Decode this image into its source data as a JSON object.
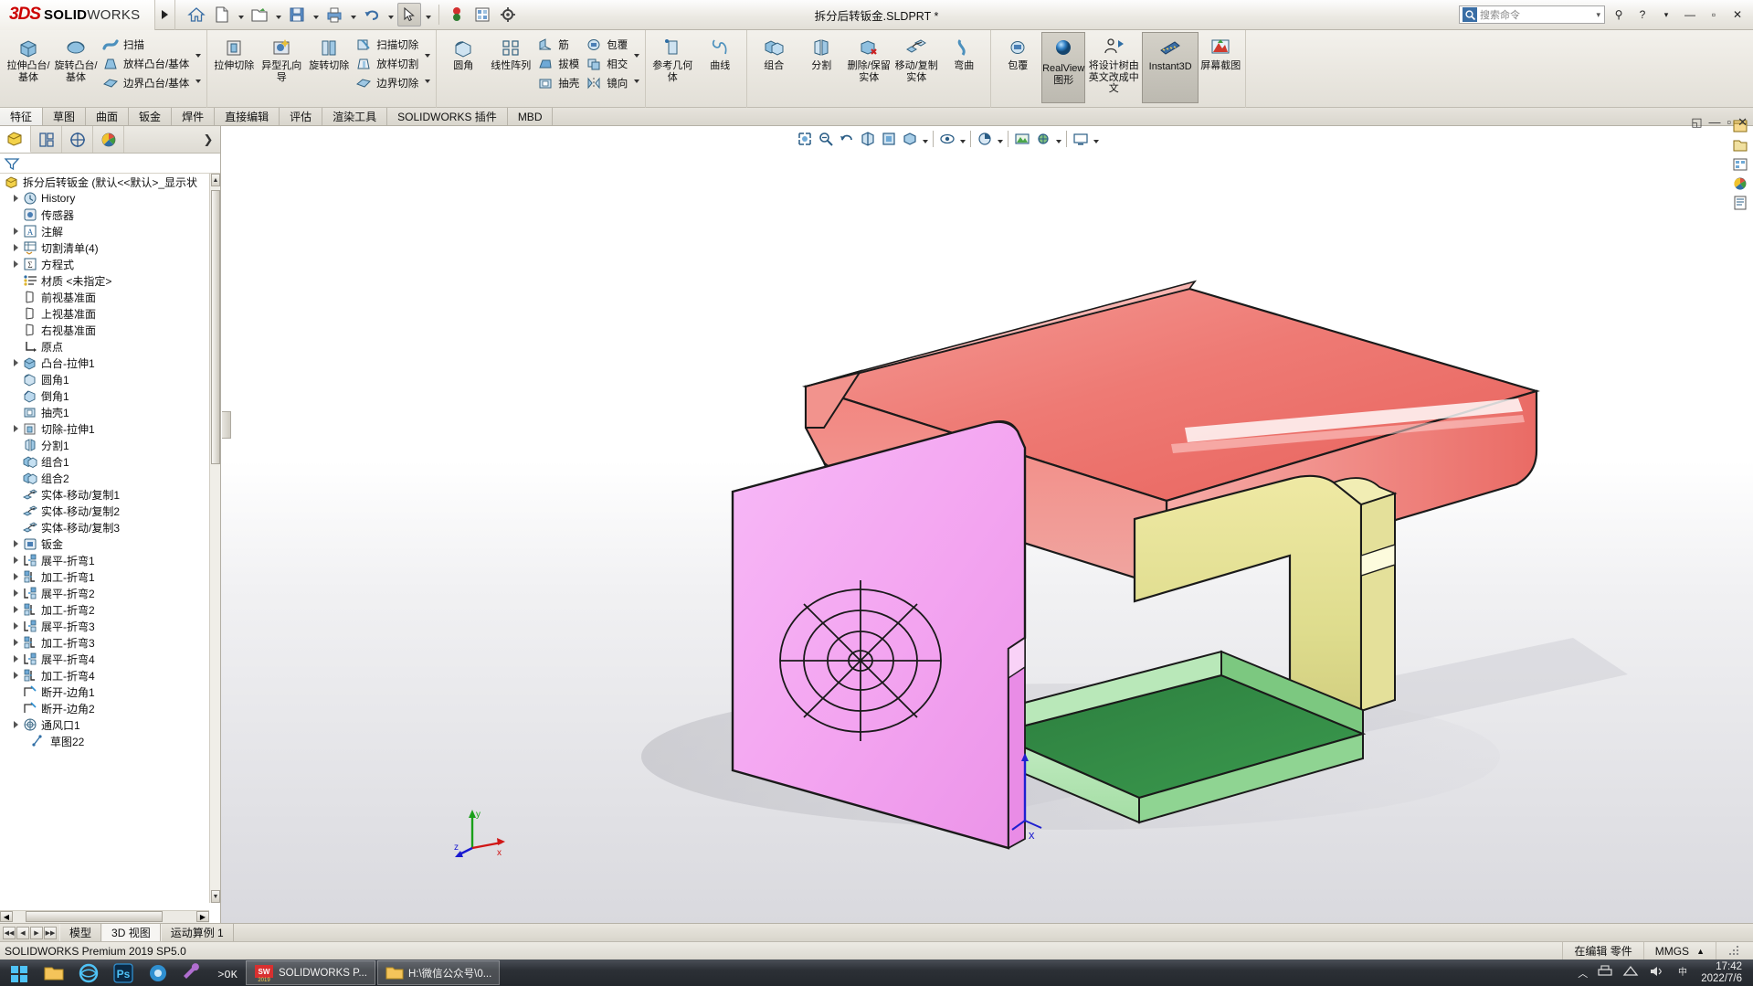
{
  "window": {
    "brand_3ds": "3DS",
    "brand_solid": "SOLID",
    "brand_works": "WORKS",
    "document_title": "拆分后转钣金.SLDPRT *",
    "search_placeholder": "搜索命令",
    "minimize": "—",
    "maximize": "▫",
    "close": "✕",
    "help": "?",
    "help_arrow": "▾",
    "pin": "⚲"
  },
  "quick_access": [
    {
      "name": "home-icon",
      "glyph": "home"
    },
    {
      "name": "new-doc-icon",
      "glyph": "newdoc"
    },
    {
      "name": "open-icon",
      "glyph": "open"
    },
    {
      "name": "save-icon",
      "glyph": "save"
    },
    {
      "name": "print-icon",
      "glyph": "print"
    },
    {
      "name": "undo-icon",
      "glyph": "undo"
    },
    {
      "name": "select-icon",
      "glyph": "cursor"
    },
    {
      "name": "rebuild-icon",
      "glyph": "rebuild"
    },
    {
      "name": "display-icon",
      "glyph": "display"
    },
    {
      "name": "options-icon",
      "glyph": "gear"
    }
  ],
  "ribbon": {
    "groups": [
      {
        "name": "features-group",
        "big": [
          {
            "label": "拉伸凸台/基体",
            "icon": "extrude-boss-icon"
          },
          {
            "label": "旋转凸台/基体",
            "icon": "revolve-boss-icon"
          }
        ],
        "small": [
          {
            "label": "扫描",
            "icon": "sweep-icon"
          },
          {
            "label": "放样凸台/基体",
            "icon": "loft-icon"
          },
          {
            "label": "边界凸台/基体",
            "icon": "boundary-boss-icon"
          }
        ]
      },
      {
        "name": "cut-group",
        "big": [
          {
            "label": "拉伸切除",
            "icon": "extrude-cut-icon"
          },
          {
            "label": "异型孔向导",
            "icon": "hole-wizard-icon"
          },
          {
            "label": "旋转切除",
            "icon": "revolve-cut-icon"
          }
        ],
        "small": [
          {
            "label": "扫描切除",
            "icon": "swept-cut-icon"
          },
          {
            "label": "放样切割",
            "icon": "lofted-cut-icon"
          },
          {
            "label": "边界切除",
            "icon": "boundary-cut-icon"
          }
        ]
      },
      {
        "name": "modify-group",
        "big": [
          {
            "label": "圆角",
            "icon": "fillet-icon"
          },
          {
            "label": "线性阵列",
            "icon": "linear-pattern-icon"
          }
        ],
        "small": [
          {
            "label": "筋",
            "icon": "rib-icon"
          },
          {
            "label": "拔模",
            "icon": "draft-icon"
          },
          {
            "label": "抽壳",
            "icon": "shell-icon"
          }
        ],
        "small2": [
          {
            "label": "包覆",
            "icon": "wrap-icon"
          },
          {
            "label": "相交",
            "icon": "intersect-icon"
          },
          {
            "label": "镜向",
            "icon": "mirror-icon"
          }
        ]
      },
      {
        "name": "reference-group",
        "big": [
          {
            "label": "参考几何体",
            "icon": "reference-geometry-icon"
          },
          {
            "label": "曲线",
            "icon": "curves-icon"
          }
        ]
      },
      {
        "name": "bodies-group",
        "big": [
          {
            "label": "组合",
            "icon": "combine-icon"
          },
          {
            "label": "分割",
            "icon": "split-icon"
          },
          {
            "label": "删除/保留实体",
            "icon": "delete-keep-body-icon"
          },
          {
            "label": "移动/复制实体",
            "icon": "move-copy-body-icon"
          },
          {
            "label": "弯曲",
            "icon": "flex-icon"
          }
        ]
      },
      {
        "name": "display-group",
        "big": [
          {
            "label": "包覆",
            "icon": "wrap2-icon"
          }
        ],
        "toggles": [
          {
            "label": "RealView 图形",
            "icon": "realview-icon",
            "active": true
          },
          {
            "label": "将设计树由英文改成中文",
            "icon": "tree-lang-icon",
            "active": false
          },
          {
            "label": "Instant3D",
            "icon": "instant3d-icon",
            "active": true
          },
          {
            "label": "屏幕截图",
            "icon": "screenshot-icon",
            "active": false
          }
        ]
      }
    ]
  },
  "tabs": [
    {
      "label": "特征",
      "active": true
    },
    {
      "label": "草图",
      "active": false
    },
    {
      "label": "曲面",
      "active": false
    },
    {
      "label": "钣金",
      "active": false
    },
    {
      "label": "焊件",
      "active": false
    },
    {
      "label": "直接编辑",
      "active": false
    },
    {
      "label": "评估",
      "active": false
    },
    {
      "label": "渲染工具",
      "active": false
    },
    {
      "label": "SOLIDWORKS 插件",
      "active": false
    },
    {
      "label": "MBD",
      "active": false
    }
  ],
  "tree": {
    "tabs": [
      {
        "name": "feature-manager-tab",
        "icon": "feature-tree-icon",
        "active": true
      },
      {
        "name": "property-manager-tab",
        "icon": "property-manager-icon",
        "active": false
      },
      {
        "name": "configuration-manager-tab",
        "icon": "configuration-icon",
        "active": false
      },
      {
        "name": "display-manager-tab",
        "icon": "display-manager-icon",
        "active": false
      }
    ],
    "more": "❯",
    "filter_icon": "filter-icon",
    "root": "拆分后转钣金  (默认<<默认>_显示状",
    "items": [
      {
        "label": "History",
        "icon": "history-icon",
        "expandable": true,
        "indent": 1
      },
      {
        "label": "传感器",
        "icon": "sensors-icon",
        "expandable": false,
        "indent": 1
      },
      {
        "label": "注解",
        "icon": "annotations-icon",
        "expandable": true,
        "indent": 1
      },
      {
        "label": "切割清单(4)",
        "icon": "cut-list-icon",
        "expandable": true,
        "indent": 1
      },
      {
        "label": "方程式",
        "icon": "equations-icon",
        "expandable": true,
        "indent": 1
      },
      {
        "label": "材质 <未指定>",
        "icon": "material-icon",
        "expandable": false,
        "indent": 1
      },
      {
        "label": "前视基准面",
        "icon": "plane-icon",
        "expandable": false,
        "indent": 1
      },
      {
        "label": "上视基准面",
        "icon": "plane-icon",
        "expandable": false,
        "indent": 1
      },
      {
        "label": "右视基准面",
        "icon": "plane-icon",
        "expandable": false,
        "indent": 1
      },
      {
        "label": "原点",
        "icon": "origin-icon",
        "expandable": false,
        "indent": 1
      },
      {
        "label": "凸台-拉伸1",
        "icon": "extrude-boss-icon",
        "expandable": true,
        "indent": 1
      },
      {
        "label": "圆角1",
        "icon": "fillet-icon",
        "expandable": false,
        "indent": 1
      },
      {
        "label": "倒角1",
        "icon": "chamfer-icon",
        "expandable": false,
        "indent": 1
      },
      {
        "label": "抽壳1",
        "icon": "shell-icon",
        "expandable": false,
        "indent": 1
      },
      {
        "label": "切除-拉伸1",
        "icon": "extrude-cut-icon",
        "expandable": true,
        "indent": 1
      },
      {
        "label": "分割1",
        "icon": "split-icon",
        "expandable": false,
        "indent": 1
      },
      {
        "label": "组合1",
        "icon": "combine-icon",
        "expandable": false,
        "indent": 1
      },
      {
        "label": "组合2",
        "icon": "combine-icon",
        "expandable": false,
        "indent": 1
      },
      {
        "label": "实体-移动/复制1",
        "icon": "move-copy-body-icon",
        "expandable": false,
        "indent": 1
      },
      {
        "label": "实体-移动/复制2",
        "icon": "move-copy-body-icon",
        "expandable": false,
        "indent": 1
      },
      {
        "label": "实体-移动/复制3",
        "icon": "move-copy-body-icon",
        "expandable": false,
        "indent": 1
      },
      {
        "label": "钣金",
        "icon": "sheetmetal-icon",
        "expandable": true,
        "indent": 1
      },
      {
        "label": "展平-折弯1",
        "icon": "flatten-bend-icon",
        "expandable": true,
        "indent": 1
      },
      {
        "label": "加工-折弯1",
        "icon": "process-bend-icon",
        "expandable": true,
        "indent": 1
      },
      {
        "label": "展平-折弯2",
        "icon": "flatten-bend-icon",
        "expandable": true,
        "indent": 1
      },
      {
        "label": "加工-折弯2",
        "icon": "process-bend-icon",
        "expandable": true,
        "indent": 1
      },
      {
        "label": "展平-折弯3",
        "icon": "flatten-bend-icon",
        "expandable": true,
        "indent": 1
      },
      {
        "label": "加工-折弯3",
        "icon": "process-bend-icon",
        "expandable": true,
        "indent": 1
      },
      {
        "label": "展平-折弯4",
        "icon": "flatten-bend-icon",
        "expandable": true,
        "indent": 1
      },
      {
        "label": "加工-折弯4",
        "icon": "process-bend-icon",
        "expandable": true,
        "indent": 1
      },
      {
        "label": "断开-边角1",
        "icon": "break-corner-icon",
        "expandable": false,
        "indent": 1
      },
      {
        "label": "断开-边角2",
        "icon": "break-corner-icon",
        "expandable": false,
        "indent": 1
      },
      {
        "label": "通风口1",
        "icon": "vent-icon",
        "expandable": true,
        "indent": 1
      },
      {
        "label": "草图22",
        "icon": "sketch-icon",
        "expandable": false,
        "indent": 2
      }
    ]
  },
  "bottom_tabs": [
    {
      "label": "模型",
      "active": false
    },
    {
      "label": "3D 视图",
      "active": true
    },
    {
      "label": "运动算例 1",
      "active": false
    }
  ],
  "status": {
    "left": "SOLIDWORKS Premium 2019 SP5.0",
    "editing": "在编辑 零件",
    "units": "MMGS",
    "units_arrow": "▲"
  },
  "taskbar": {
    "apps": [
      {
        "label": "SOLIDWORKS P...",
        "icon": "solidworks-taskbar-icon",
        "year": "2019"
      },
      {
        "label": "H:\\微信公众号\\0...",
        "icon": "folder-taskbar-icon"
      }
    ],
    "pinned": [
      {
        "name": "start-icon"
      },
      {
        "name": "file-explorer-icon"
      },
      {
        "name": "browser-icon"
      },
      {
        "name": "photoshop-icon"
      },
      {
        "name": "media-icon"
      },
      {
        "name": "tool-icon"
      },
      {
        "name": "code-icon"
      }
    ],
    "time": "17:42",
    "date": "2022/7/6",
    "tray_arrow": "︿"
  },
  "model_colors": {
    "red_top": "#f0736e",
    "red_light": "#f7a7a3",
    "pink_panel": "#f0a8f0",
    "pink_light": "#f8c8f8",
    "yellow_panel": "#ddd98a",
    "yellow_light": "#f0ecb0",
    "green_base": "#2f7f3f",
    "green_light": "#a8e0a8",
    "outline": "#1a1a1a"
  },
  "viewport": {
    "triad_x": "x",
    "triad_y": "y",
    "triad_z": "z",
    "origin_marker": "origin-triad"
  }
}
